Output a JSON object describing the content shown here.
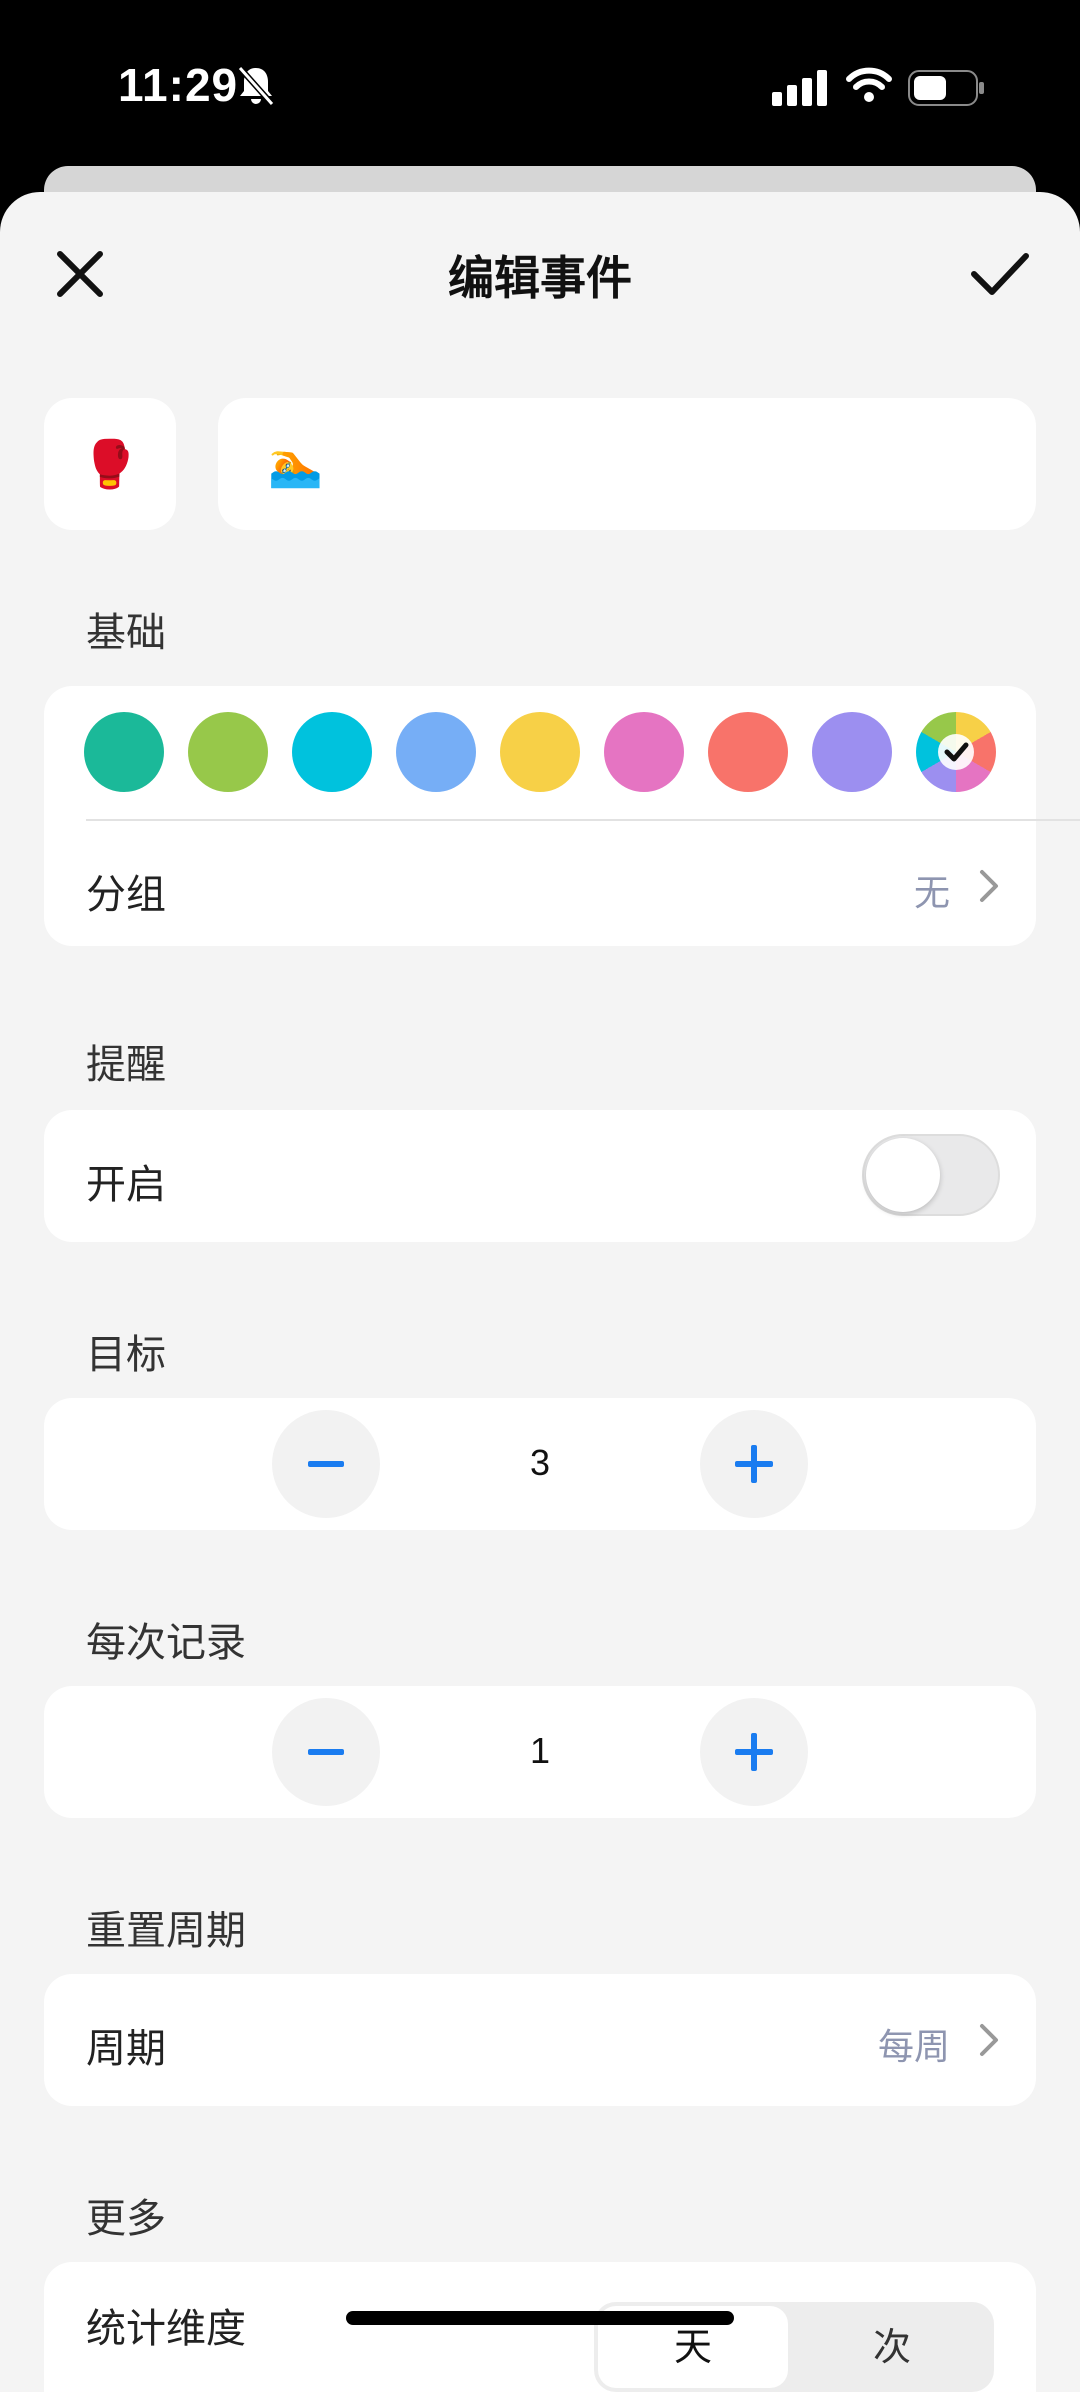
{
  "status_bar": {
    "time": "11:29"
  },
  "nav": {
    "title": "编辑事件"
  },
  "event": {
    "icon_emoji": "🥊",
    "name_emoji": "🏊"
  },
  "basics": {
    "section_title": "基础",
    "colors": [
      "#1bb999",
      "#97c84a",
      "#00c2dd",
      "#76aef6",
      "#f7d047",
      "#e574c2",
      "#f8736a",
      "#9c8ff0"
    ],
    "custom_color_selected": true,
    "group_label": "分组",
    "group_value": "无"
  },
  "reminder": {
    "section_title": "提醒",
    "enable_label": "开启",
    "enabled": false
  },
  "goal": {
    "section_title": "目标",
    "value": "3"
  },
  "per_record": {
    "section_title": "每次记录",
    "value": "1"
  },
  "reset": {
    "section_title": "重置周期",
    "period_label": "周期",
    "period_value": "每周"
  },
  "more": {
    "section_title": "更多",
    "stats_label": "统计维度",
    "segment_options": [
      "天",
      "次"
    ]
  },
  "accent_color": "#1a7cf0"
}
